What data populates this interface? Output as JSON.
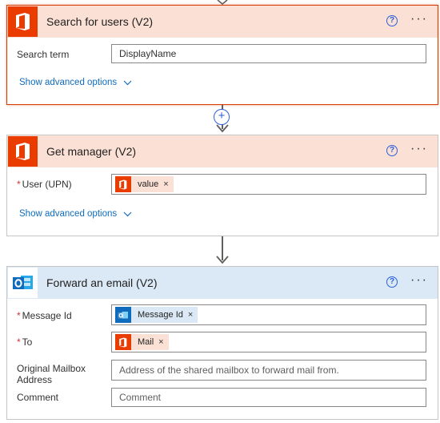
{
  "cards": [
    {
      "title": "Search for users (V2)",
      "fields": [
        {
          "label": "Search term",
          "value": "DisplayName"
        }
      ],
      "advanced_label": "Show advanced options"
    },
    {
      "title": "Get manager (V2)",
      "fields": [
        {
          "label": "User (UPN)",
          "token": "value"
        }
      ],
      "advanced_label": "Show advanced options"
    },
    {
      "title": "Forward an email (V2)",
      "fields": [
        {
          "label": "Message Id",
          "token": "Message Id"
        },
        {
          "label": "To",
          "token": "Mail"
        },
        {
          "label": "Original Mailbox Address",
          "placeholder": "Address of the shared mailbox to forward mail from."
        },
        {
          "label": "Comment",
          "placeholder": "Comment"
        }
      ]
    }
  ],
  "controls": {
    "help_glyph": "?",
    "more_glyph": "···",
    "remove_glyph": "×",
    "add_glyph": "+",
    "required_glyph": "*"
  },
  "icons": {
    "office": "office-logo-icon",
    "outlook": "outlook-logo-icon"
  },
  "colors": {
    "office_accent": "#eb3c00",
    "office_header": "#fbe0d6",
    "outlook_accent": "#0f6cbd",
    "outlook_header": "#dbe9f6",
    "link": "#0f6cbd",
    "required": "#d13438",
    "selected_border": "#d83b01"
  }
}
